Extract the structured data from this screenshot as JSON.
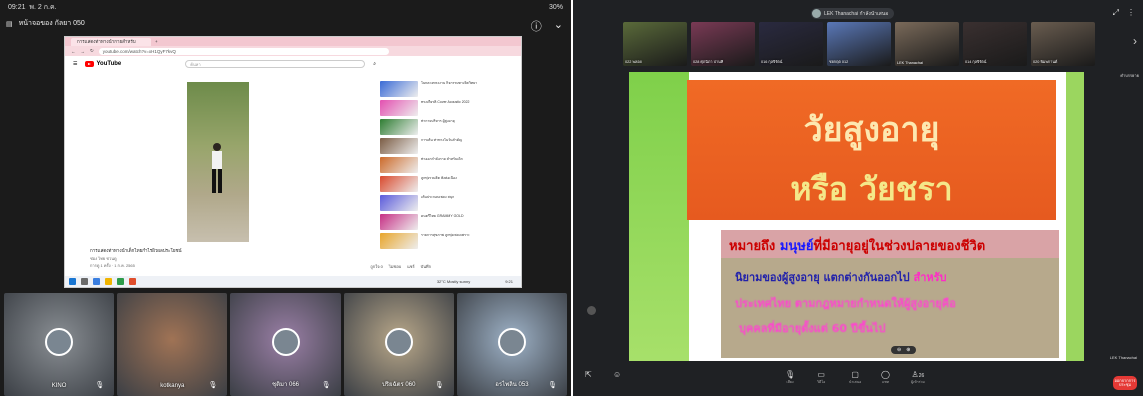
{
  "status_bar": {
    "time": "09:21",
    "date": "พ. 2 ก.ค.",
    "battery": "30%"
  },
  "app": {
    "title": "หน้าจอของ กัลยา 050"
  },
  "browser": {
    "tab_label": "การแสดงท่าทางนำกายสำหรับ",
    "url": "youtube.com/watch?v=xH1QyF7kvQ",
    "search_placeholder": "ค้นหา",
    "logo": "YouTube",
    "video_title": "การแสดงท่าทางนำเด็กไทยกำไรผิวผลประโยชน์",
    "video_channel": "ช่อง ไทย ชวนดู",
    "video_meta": "การดู 1 ครั้ง · 1 ก.ค. 2565",
    "actions": [
      "ถูกใจ 0",
      "ไม่ชอบ",
      "แชร์",
      "บันทึก"
    ],
    "recs": [
      {
        "t": "ในหลวงทรงงาน กิจกรรมทางจิตวิทยา",
        "c": "#3a6bd6"
      },
      {
        "t": "ทรงเกียรติ Cover Acoustic 2022",
        "c": "#e34fb0"
      },
      {
        "t": "ท่ากายบริหาร ผู้สูงอายุ",
        "c": "#2e7d32"
      },
      {
        "t": "การเต้น ท่าทางในวันสำคัญ",
        "c": "#7b5c44"
      },
      {
        "t": "ท่าออกกำลังกาย สำหรับเด็ก",
        "c": "#cc6a2a"
      },
      {
        "t": "ลูกทุ่งรวมฮิต ฟังต่อเนื่อง",
        "c": "#d94a2e"
      },
      {
        "t": "เต้นประกอบเพลง สนุก",
        "c": "#5a5adb"
      },
      {
        "t": "ดนตรีไทย GRAMMY GOLD",
        "c": "#c62f85"
      },
      {
        "t": "รายการสุขภาพ ลูกทุ่งเพลงเพราะ",
        "c": "#e8a52a"
      }
    ],
    "weather": "32°C Mostly sunny",
    "clock": "9:21"
  },
  "participants": [
    {
      "name": "KINO",
      "bg": "#8a8f94"
    },
    {
      "name": "kotkanya",
      "bg": "#a07355"
    },
    {
      "name": "ชุติมา 066",
      "bg": "#9a7fa6"
    },
    {
      "name": "ปริยฉัตร 060",
      "bg": "#b9a88a"
    },
    {
      "name": "อรไพลิน 053",
      "bg": "#9eb2c7"
    }
  ],
  "meeting": {
    "title": "LEK Thanachai กำลังนำเสนอ",
    "strip": [
      {
        "label": "022 พลอย",
        "c": "#5a6a3a"
      },
      {
        "label": "028 ศุภนิภา ปานทิ",
        "c": "#7a3a55"
      },
      {
        "label": "016 กุลจิรัตน์",
        "c": "#2a2a40"
      },
      {
        "label": "ชยกฤต 012",
        "c": "#5a78b8"
      },
      {
        "label": "LEK Thanachai",
        "c": "#7a6a5a"
      },
      {
        "label": "014 กุลจิรัตน์",
        "c": "#3a3030"
      },
      {
        "label": "020 พิมพกานต์",
        "c": "#6a5d50"
      }
    ],
    "side_caption": "คำบรรยาย",
    "presenter_label": "LEK Thanachai",
    "participant_count": "26",
    "end_label": "ออกจากการประชุม",
    "controls": [
      "เสียง",
      "วิดีโอ",
      "นำเสนอ",
      "แชท",
      "ผู้เข้าร่วม"
    ]
  },
  "slide": {
    "line1": "วัยสูงอายุ",
    "line2": "หรือ วัยชรา",
    "def_prefix": "หมายถึง",
    "def_word": "มนุษย์",
    "def_rest": "ที่มีอายุอยู่ในช่วงปลายของชีวิต",
    "def2_a": "นิยามของผู้สูงอายุ แตกต่างกันออกไป",
    "def2_b": "สำหรับ",
    "def3": "ประเทศไทย ตามกฎหมายกำหนดให้ผู้สูงอายุคือ",
    "def4": "บุคคลที่มีอายุตั้งแต่ 60 ปีขึ้นไป"
  }
}
